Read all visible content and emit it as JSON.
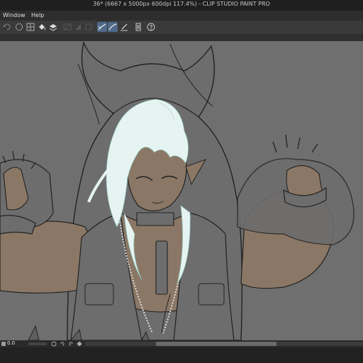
{
  "window": {
    "title": "36* (6667 x 5000px 600dpi 117.4%) - CLIP STUDIO PAINT PRO"
  },
  "menubar": {
    "items": [
      {
        "label": "Window"
      },
      {
        "label": "Help"
      }
    ]
  },
  "toolbar": {
    "icons": [
      "undo-icon",
      "lasso-select-icon",
      "grid-icon",
      "fill-icon",
      "layer-icon",
      "ruler-disabled-icon",
      "gradient-disabled-icon",
      "frame-disabled-icon",
      "vector-pen-icon",
      "vector-correct-icon",
      "ruler-pen-icon",
      "document-icon",
      "help-icon"
    ]
  },
  "status": {
    "rotation": "0.0"
  },
  "colors": {
    "canvas": "#6f6f6f",
    "skin": "#8b7765",
    "hair": "#e6f4f1",
    "accent": "#4f6a8a"
  }
}
